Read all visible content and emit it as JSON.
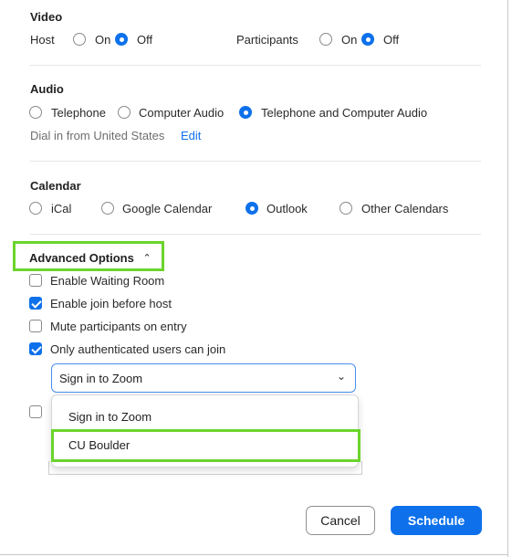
{
  "video": {
    "heading": "Video",
    "host_label": "Host",
    "host_on": "On",
    "host_off": "Off",
    "participants_label": "Participants",
    "participants_on": "On",
    "participants_off": "Off"
  },
  "audio": {
    "heading": "Audio",
    "options": [
      "Telephone",
      "Computer Audio",
      "Telephone and Computer Audio"
    ],
    "selected": "Telephone and Computer Audio",
    "dial_in_text": "Dial in from United States",
    "edit_link": "Edit"
  },
  "calendar": {
    "heading": "Calendar",
    "options": [
      "iCal",
      "Google Calendar",
      "Outlook",
      "Other Calendars"
    ],
    "selected": "Outlook"
  },
  "advanced": {
    "heading": "Advanced Options",
    "toggle_icon": "chevron-up-icon",
    "options": [
      {
        "label": "Enable Waiting Room",
        "checked": false
      },
      {
        "label": "Enable join before host",
        "checked": true
      },
      {
        "label": "Mute participants on entry",
        "checked": false
      },
      {
        "label": "Only authenticated users can join",
        "checked": true
      }
    ],
    "auth_select": {
      "value": "Sign in to Zoom",
      "options": [
        "Sign in to Zoom",
        "CU Boulder"
      ],
      "highlighted": "CU Boulder"
    }
  },
  "footer": {
    "cancel_label": "Cancel",
    "schedule_label": "Schedule"
  },
  "colors": {
    "accent": "#0e71eb",
    "highlight": "#6bd42c"
  }
}
